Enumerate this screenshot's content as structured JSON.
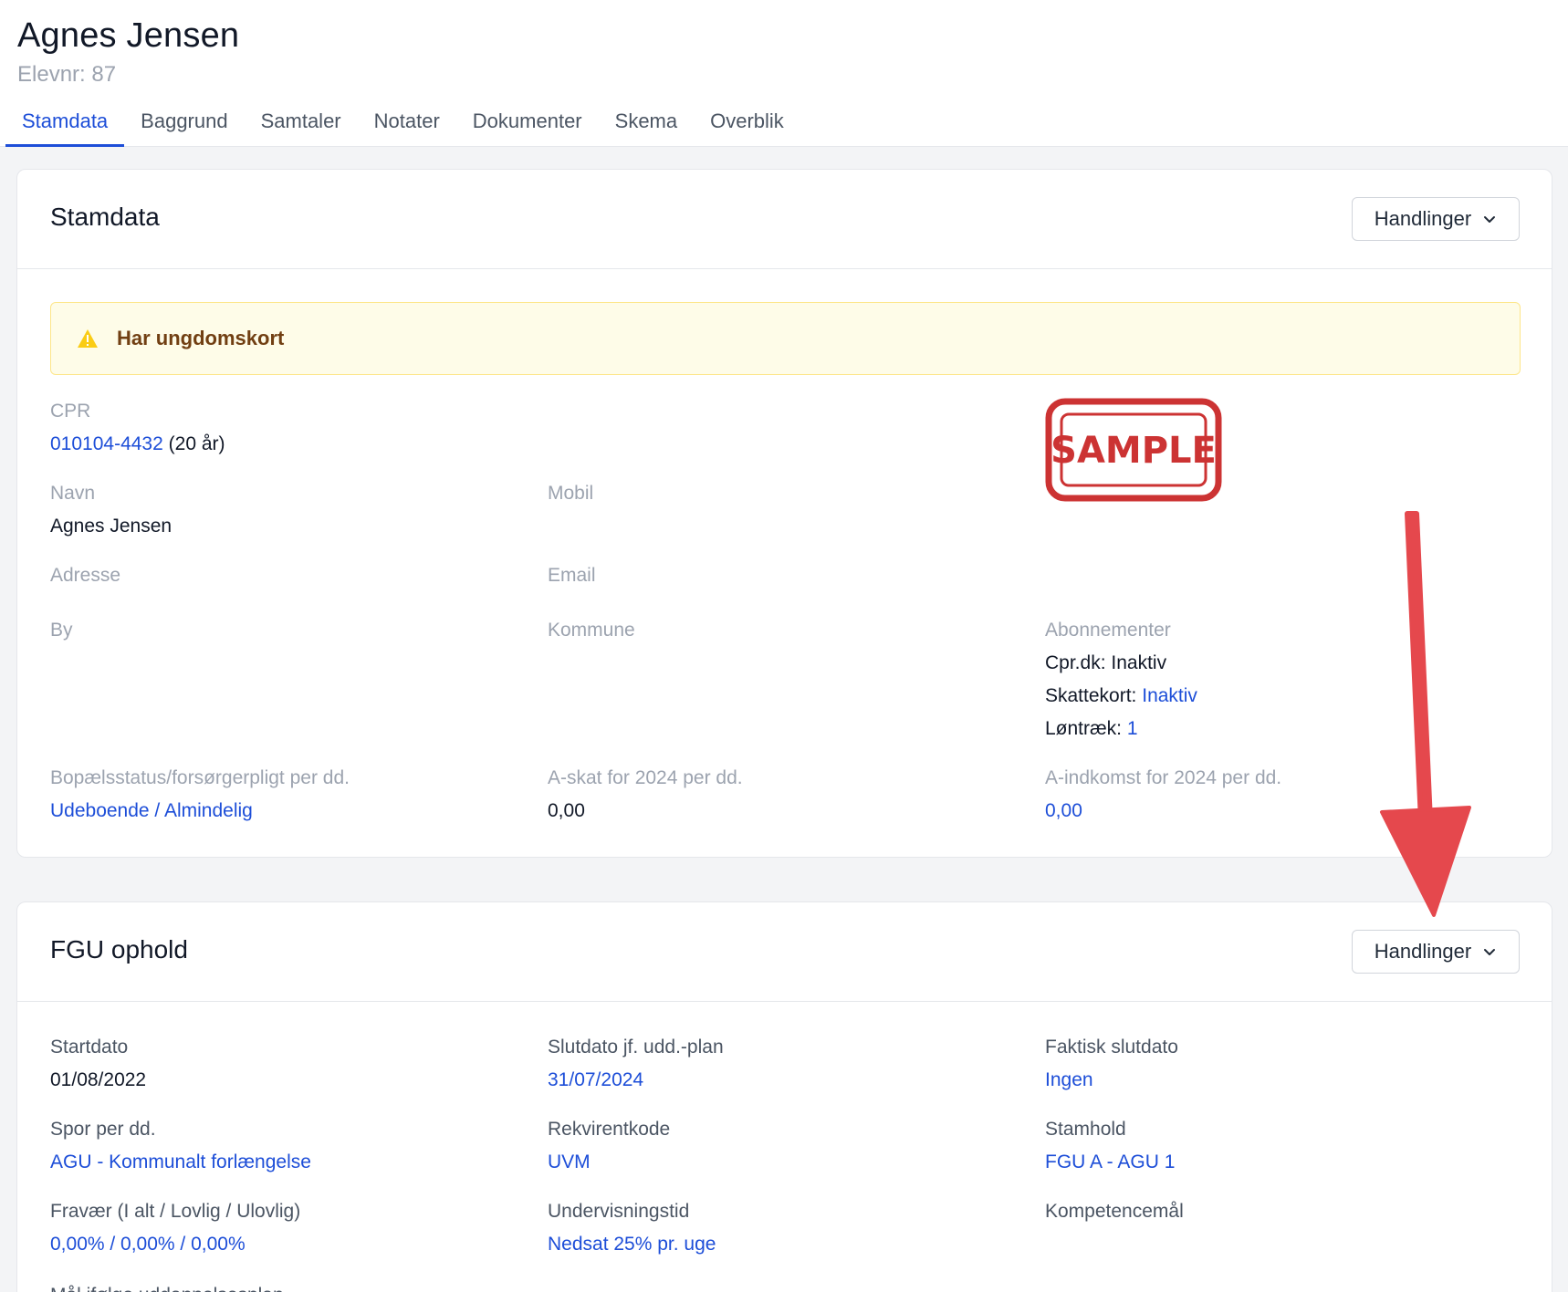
{
  "student": {
    "name": "Agnes Jensen",
    "number": "Elevnr: 87"
  },
  "tabs": [
    "Stamdata",
    "Baggrund",
    "Samtaler",
    "Notater",
    "Dokumenter",
    "Skema",
    "Overblik"
  ],
  "stamdata": {
    "title": "Stamdata",
    "actions_label": "Handlinger",
    "alert": "Har ungdomskort",
    "stamp_text": "SAMPLE",
    "cpr": {
      "label": "CPR",
      "value": "010104-4432",
      "age": "(20 år)"
    },
    "navn": {
      "label": "Navn",
      "value": "Agnes Jensen"
    },
    "mobil": {
      "label": "Mobil"
    },
    "adresse": {
      "label": "Adresse"
    },
    "email": {
      "label": "Email"
    },
    "by": {
      "label": "By"
    },
    "kommune": {
      "label": "Kommune"
    },
    "abonnementer": {
      "label": "Abonnementer",
      "cpr_dk_label": "Cpr.dk:",
      "cpr_dk_value": "Inaktiv",
      "skattekort_label": "Skattekort:",
      "skattekort_value": "Inaktiv",
      "lontraek_label": "Løntræk:",
      "lontraek_value": "1"
    },
    "bopael": {
      "label": "Bopælsstatus/forsørgerpligt per dd.",
      "value": "Udeboende / Almindelig"
    },
    "askat": {
      "label": "A-skat for 2024 per dd.",
      "value": "0,00"
    },
    "aindkomst": {
      "label": "A-indkomst for 2024 per dd.",
      "value": "0,00"
    }
  },
  "fgu": {
    "title": "FGU ophold",
    "actions_label": "Handlinger",
    "startdato": {
      "label": "Startdato",
      "value": "01/08/2022"
    },
    "slutdato_plan": {
      "label": "Slutdato jf. udd.-plan",
      "value": "31/07/2024"
    },
    "faktisk_slutdato": {
      "label": "Faktisk slutdato",
      "value": "Ingen"
    },
    "spor": {
      "label": "Spor per dd.",
      "value": "AGU - Kommunalt forlængelse"
    },
    "rekvirentkode": {
      "label": "Rekvirentkode",
      "value": "UVM"
    },
    "stamhold": {
      "label": "Stamhold",
      "value": "FGU A - AGU 1"
    },
    "fravaer": {
      "label": "Fravær (I alt / Lovlig / Ulovlig)",
      "value": "0,00% / 0,00% / 0,00%"
    },
    "undervisningstid": {
      "label": "Undervisningstid",
      "value": "Nedsat 25% pr. uge"
    },
    "kompetencemaal": {
      "label": "Kompetencemål"
    },
    "maal": {
      "label": "Mål ifølge uddannelsesplan"
    }
  },
  "colors": {
    "link": "#1d4ed8",
    "alert_bg": "#fefce8",
    "arrow": "#e5484d",
    "stamp": "#cc3333"
  }
}
